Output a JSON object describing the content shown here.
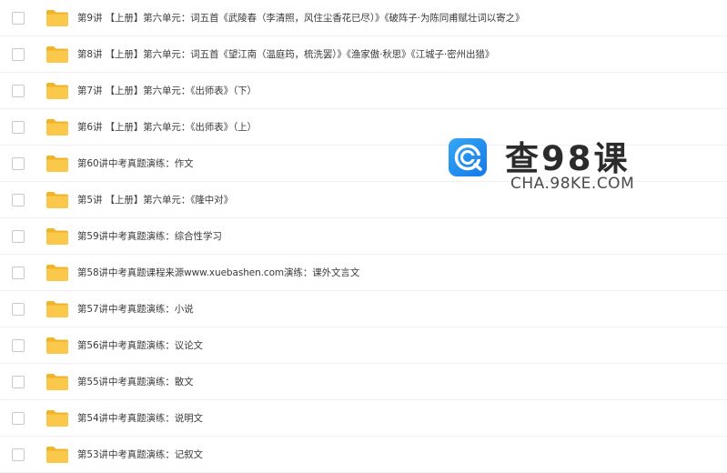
{
  "file_list": {
    "rows": [
      {
        "label": "第9讲 【上册】第六单元：词五首《武陵春（李清照，风住尘香花已尽）》《破阵子·为陈同甫赋壮词以寄之》"
      },
      {
        "label": "第8讲 【上册】第六单元：词五首《望江南（温庭筠，梳洗罢）》《渔家傲·秋思》《江城子·密州出猎》"
      },
      {
        "label": "第7讲 【上册】第六单元：《出师表》（下）"
      },
      {
        "label": "第6讲 【上册】第六单元：《出师表》（上）"
      },
      {
        "label": "第60讲中考真题演练：作文"
      },
      {
        "label": "第5讲 【上册】第六单元：《隆中对》"
      },
      {
        "label": "第59讲中考真题演练：综合性学习"
      },
      {
        "label": "第58讲中考真题课程来源www.xuebashen.com演练：课外文言文"
      },
      {
        "label": "第57讲中考真题演练：小说"
      },
      {
        "label": "第56讲中考真题演练：议论文"
      },
      {
        "label": "第55讲中考真题演练：散文"
      },
      {
        "label": "第54讲中考真题演练：说明文"
      },
      {
        "label": "第53讲中考真题演练：记叙文"
      }
    ],
    "folder_icon": "folder-icon",
    "folder_color": "#f9c642"
  },
  "watermark": {
    "title": "查98课",
    "url": "CHA.98KE.COM",
    "logo_color": "#1f8ef1"
  }
}
